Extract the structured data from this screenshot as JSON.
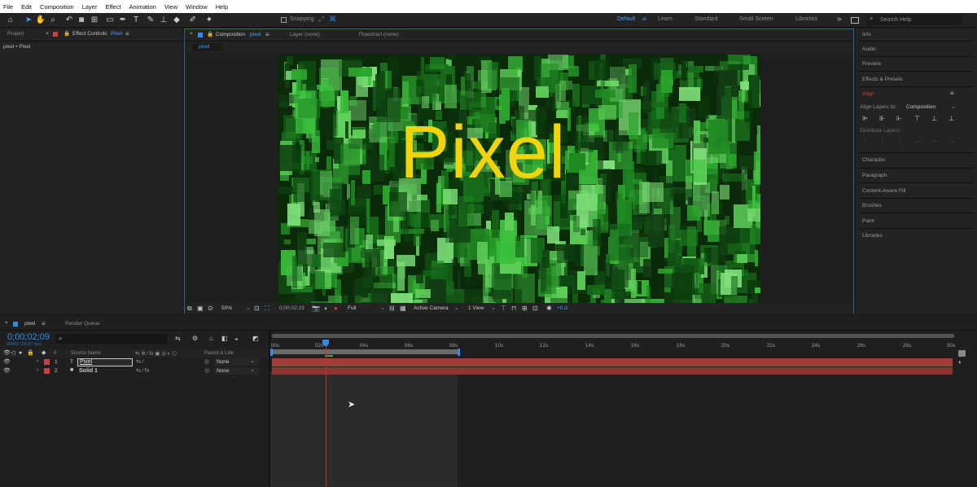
{
  "menu": [
    "File",
    "Edit",
    "Composition",
    "Layer",
    "Effect",
    "Animation",
    "View",
    "Window",
    "Help"
  ],
  "toolbar": {
    "snapping_label": "Snapping",
    "workspaces": [
      {
        "label": "Default",
        "active": true
      },
      {
        "label": "Learn",
        "active": false
      },
      {
        "label": "Standard",
        "active": false
      },
      {
        "label": "Small Screen",
        "active": false
      },
      {
        "label": "Libraries",
        "active": false
      }
    ],
    "overflow": "»",
    "search_placeholder": "Search Help"
  },
  "left_panel": {
    "tab_project": "Project",
    "tab_effect_controls": "Effect Controls",
    "effect_controls_layer": "Pixel",
    "breadcrumb": "pixel • Pixel"
  },
  "comp_panel": {
    "tab_composition": "Composition",
    "comp_name": "pixel",
    "tab_layer": "Layer (none)",
    "tab_flowchart": "Flowchart (none)",
    "comp_chip": "pixel",
    "canvas_text": "Pixel",
    "footer": {
      "zoom": "50%",
      "timecode": "0;00;02;19",
      "resolution": "Full",
      "camera": "Active Camera",
      "views": "1 View",
      "exposure": "+0.0"
    }
  },
  "right_panel": {
    "items_top": [
      "Info",
      "Audio",
      "Preview",
      "Effects & Presets"
    ],
    "align_title": "Align",
    "align_layers_to_label": "Align Layers to:",
    "align_layers_to_value": "Composition",
    "distribute_label": "Distribute Layers:",
    "items_bottom": [
      "Character",
      "Paragraph",
      "Content-Aware Fill",
      "Brushes",
      "Paint",
      "Libraries"
    ]
  },
  "timeline": {
    "tab_comp": "pixel",
    "tab_render": "Render Queue",
    "timecode": "0;00;02;09",
    "subframes": "00069 (29.97 fps)",
    "search_placeholder": "",
    "col_source_name": "Source Name",
    "col_parent": "Parent & Link",
    "ruler": [
      "00s",
      "02s",
      "04s",
      "06s",
      "08s",
      "10s",
      "12s",
      "14s",
      "16s",
      "18s",
      "20s",
      "22s",
      "24s",
      "26s",
      "28s",
      "30s"
    ],
    "layers": [
      {
        "num": "1",
        "type": "T",
        "name": "Pixel",
        "parent": "None",
        "selected": true
      },
      {
        "num": "2",
        "type": "■",
        "name": "Solid 1",
        "parent": "None",
        "selected": false
      }
    ]
  },
  "colors": {
    "accent_blue": "#2d8ceb",
    "canvas_text": "#f2d40a",
    "layer_bar": "#a33c3a",
    "layer_label": "#c84040",
    "playhead": "#c83030"
  }
}
